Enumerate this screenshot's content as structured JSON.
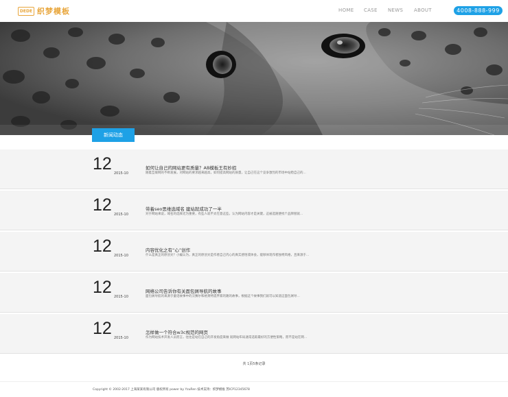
{
  "header": {
    "logo_mark": "DEDE",
    "logo_text": "织梦模板",
    "nav": [
      {
        "label": "HOME"
      },
      {
        "label": "CASE"
      },
      {
        "label": "NEWS"
      },
      {
        "label": "ABOUT"
      }
    ],
    "phone": "4008-888-999"
  },
  "section": {
    "tab_label": "新闻动态"
  },
  "news": [
    {
      "day": "12",
      "year_month": "2015-10",
      "title": "如何让自己的网站更有质量？AB模板王有妙招",
      "summary": "随着互联网的不断发展，对网站的要求越来越高，如何提高网站的质量，让自己在这个竞争激烈的市场中站稳自己的..."
    },
    {
      "day": "12",
      "year_month": "2015-10",
      "title": "带着seo思维选域名 建站就成功了一半",
      "summary": "对于网站来说，域名的选择尤为重要，有些人就不太在意这些，认为网站内容才是关键，这被选随便找个品牌替就..."
    },
    {
      "day": "12",
      "year_month": "2015-10",
      "title": "内容优化之有“心”创作",
      "summary": "什么是真正的原创文？小编认为，真正的原创文是作者自己内心的真实感悟或体会，能够体现作者独特风格，且来源于..."
    },
    {
      "day": "12",
      "year_month": "2015-10",
      "title": "网络公司告诉你有关面包屑导航的故事",
      "summary": "面包屑导航的来源于童话故事中的汉赛尔和格莱特遗弃家的路的故事，根据这个故事我们就可以知道这面包屑导..."
    },
    {
      "day": "12",
      "year_month": "2015-10",
      "title": "怎样做一个符合w3c规范的网页",
      "summary": "作为网站技术开发人员而言，往往是站在自己的开发角度来做 就网站布局通常选取最好的方便性策略，而不是站在网..."
    }
  ],
  "pager": {
    "text": "共 1页5条记录"
  },
  "footer": {
    "text": "Copyright © 2002-2017 上海某某有限公司 版权所有 power by YzuRen 技术支持：织梦模板   苏ICP12345678"
  }
}
